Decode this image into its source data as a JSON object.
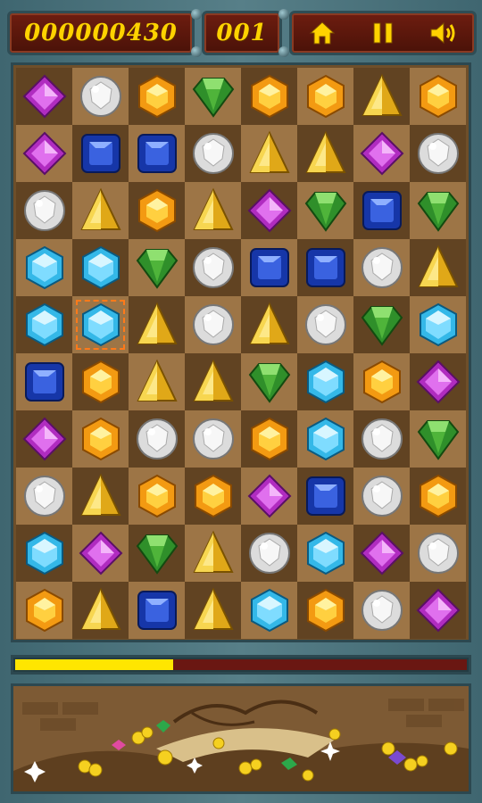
{
  "hud": {
    "score": "000000430",
    "moves": "001",
    "controls": [
      {
        "icon": "home-icon"
      },
      {
        "icon": "pause-icon"
      },
      {
        "icon": "sound-icon"
      }
    ]
  },
  "colors": {
    "hud_text": "#ffd200",
    "progress_fill": "#ffe600",
    "progress_track": "#6a1712",
    "selection": "#ff7a1a"
  },
  "board": {
    "columns": 8,
    "rows": 10,
    "selected_cell": {
      "row": 4,
      "col": 1
    },
    "grid": [
      [
        "purple",
        "white",
        "orange",
        "green",
        "orange",
        "orange",
        "yellow",
        "orange"
      ],
      [
        "purple",
        "blue",
        "blue",
        "white",
        "yellow",
        "yellow",
        "purple",
        "white"
      ],
      [
        "white",
        "yellow",
        "orange",
        "yellow",
        "purple",
        "green",
        "blue",
        "green"
      ],
      [
        "cyan",
        "cyan",
        "green",
        "white",
        "blue",
        "blue",
        "white",
        "yellow"
      ],
      [
        "cyan",
        "cyan",
        "yellow",
        "white",
        "yellow",
        "white",
        "green",
        "cyan"
      ],
      [
        "blue",
        "orange",
        "yellow",
        "yellow",
        "green",
        "cyan",
        "orange",
        "purple"
      ],
      [
        "purple",
        "orange",
        "white",
        "white",
        "orange",
        "cyan",
        "white",
        "green"
      ],
      [
        "white",
        "yellow",
        "orange",
        "orange",
        "purple",
        "blue",
        "white",
        "orange"
      ],
      [
        "cyan",
        "purple",
        "green",
        "yellow",
        "white",
        "cyan",
        "purple",
        "white"
      ],
      [
        "orange",
        "yellow",
        "blue",
        "yellow",
        "cyan",
        "orange",
        "white",
        "purple"
      ]
    ]
  },
  "progress": {
    "fraction": 0.35
  }
}
